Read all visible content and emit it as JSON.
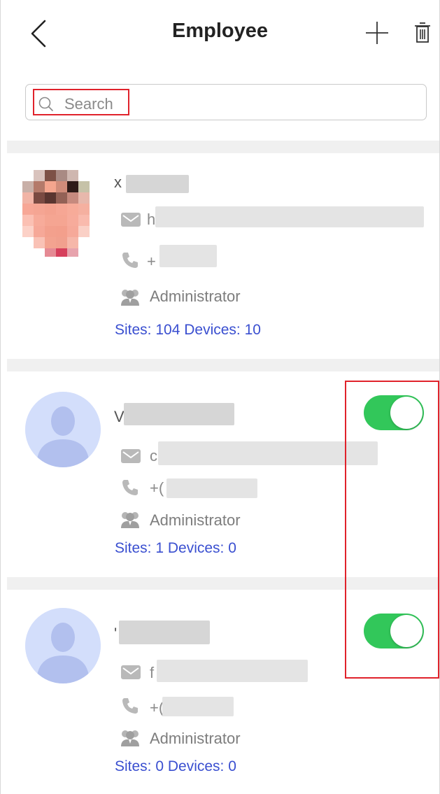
{
  "header": {
    "title": "Employee"
  },
  "search": {
    "placeholder": "Search"
  },
  "employees": [
    {
      "role": "Administrator",
      "stats": "Sites: 104  Devices: 10",
      "email_prefix": "h",
      "phone_prefix": "+",
      "name_prefix": "x"
    },
    {
      "role": "Administrator",
      "stats": "Sites: 1  Devices: 0",
      "email_prefix": "c",
      "phone_prefix": "+(",
      "name_prefix": "V",
      "enabled": true
    },
    {
      "role": "Administrator",
      "stats": "Sites: 0  Devices: 0",
      "email_prefix": "f",
      "phone_prefix": "+(",
      "name_prefix": "'",
      "enabled": true
    }
  ],
  "colors": {
    "accent_blue": "#3a4fd0",
    "toggle_on": "#32c75a",
    "highlight_red": "#e0222b"
  },
  "icons": [
    "back-icon",
    "add-icon",
    "trash-icon",
    "search-icon",
    "mail-icon",
    "phone-icon",
    "role-icon"
  ]
}
